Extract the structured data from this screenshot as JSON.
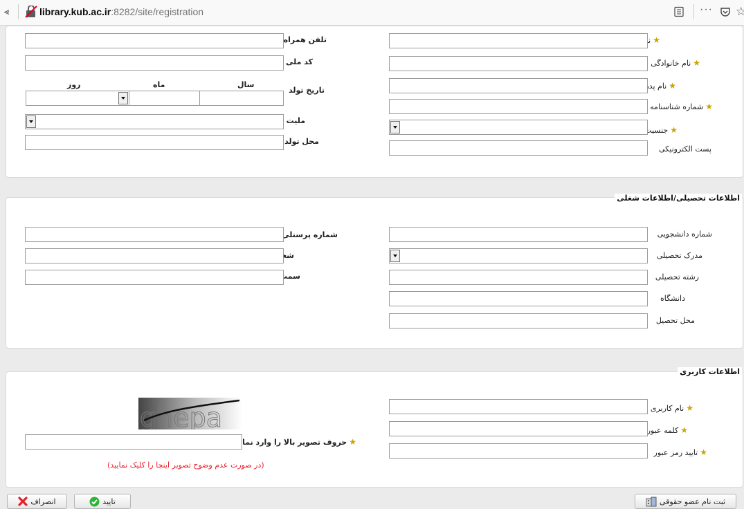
{
  "browser": {
    "url_host": "library.kub.ac.ir",
    "url_rest": ":8282/site/registration",
    "more_label": "···"
  },
  "personal": {
    "left": {
      "mobile": "تلفن همراه",
      "national_code": "کد ملی",
      "birth_date": "تاریخ تولد",
      "year": "سال",
      "month": "ماه",
      "day": "روز",
      "nationality": "ملیت",
      "birth_place": "محل تولد"
    },
    "right": {
      "first_name": "نام",
      "last_name": "نام خانوادگی",
      "father_name": "نام پدر",
      "id_number": "شماره شناسنامه",
      "gender": "جنسیت",
      "email": "پست الکترونیکی"
    }
  },
  "education": {
    "title": "اطلاعات تحصیلی/اطلاعات شغلی",
    "personnel_number": "شماره پرسنلی",
    "job": "شغل",
    "position": "سمت",
    "student_number": "شماره دانشجویی",
    "degree": "مدرک تحصیلی",
    "field": "رشته تحصیلی",
    "university": "دانشگاه",
    "study_place": "محل تحصیل"
  },
  "user": {
    "title": "اطلاعات کاربری",
    "username": "نام کاربری",
    "password": "کلمه عبور",
    "confirm_password": "تایید رمز عبور",
    "captcha_prompt": "حروف تصویر بالا را وارد نمایید",
    "captcha_text": "ghepa",
    "captcha_note": "(در صورت عدم وضوح تصویر اینجا را کلیک نمایید)"
  },
  "buttons": {
    "cancel": "انصراف",
    "confirm": "تایید",
    "legal": "ثبت نام عضو حقوقی"
  },
  "colors": {
    "star": "#c9a400",
    "note_red": "#e8202c",
    "confirm_green": "#2bb534",
    "cancel_red": "#e0222b"
  }
}
